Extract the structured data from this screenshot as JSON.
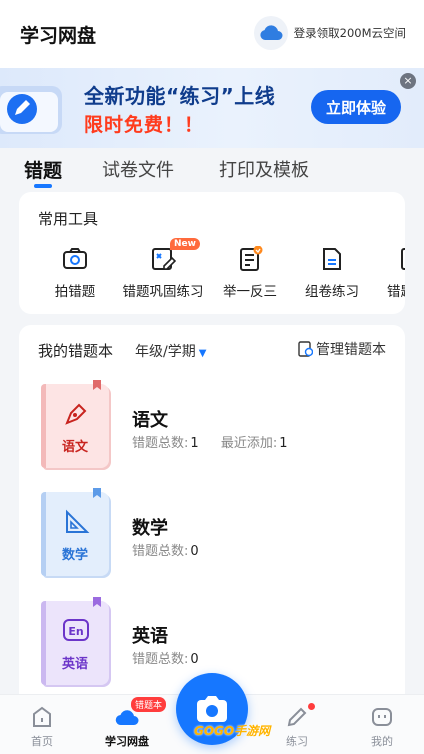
{
  "header": {
    "title": "学习网盘",
    "login_text": "登录领取200M云空间"
  },
  "banner": {
    "title": "全新功能“练习”上线",
    "subtitle": "限时免费！！",
    "button": "立即体验",
    "close": "×"
  },
  "tabs": [
    {
      "label": "错题"
    },
    {
      "label": "试卷文件"
    },
    {
      "label": "打印及模板"
    }
  ],
  "tools": {
    "heading": "常用工具",
    "new_badge": "New",
    "items": [
      {
        "label": "拍错题",
        "icon": "camera-icon"
      },
      {
        "label": "错题巩固练习",
        "icon": "practice-icon"
      },
      {
        "label": "举一反三",
        "icon": "list-icon"
      },
      {
        "label": "组卷练习",
        "icon": "document-icon"
      },
      {
        "label": "错题",
        "icon": "more-icon"
      }
    ]
  },
  "notebooks": {
    "heading": "我的错题本",
    "grade_select": "年级/学期",
    "manage": "管理错题本",
    "items": [
      {
        "subject": "语文",
        "title": "语文",
        "total_label": "错题总数:",
        "total": "1",
        "recent_label": "最近添加:",
        "recent": "1",
        "color": "#d9302c"
      },
      {
        "subject": "数学",
        "title": "数学",
        "total_label": "错题总数:",
        "total": "0",
        "color": "#2f7de1"
      },
      {
        "subject": "英语",
        "title": "英语",
        "total_label": "错题总数:",
        "total": "0",
        "color": "#7b3fd4"
      }
    ]
  },
  "bottom_nav": {
    "items": [
      {
        "label": "首页"
      },
      {
        "label": "学习网盘"
      },
      {
        "label": "练习"
      },
      {
        "label": "我的"
      }
    ],
    "badge": "错题本",
    "watermark": "GOGO手游网"
  },
  "colors": {
    "accent": "#1677ff",
    "promo_red": "#ff3b1d"
  }
}
